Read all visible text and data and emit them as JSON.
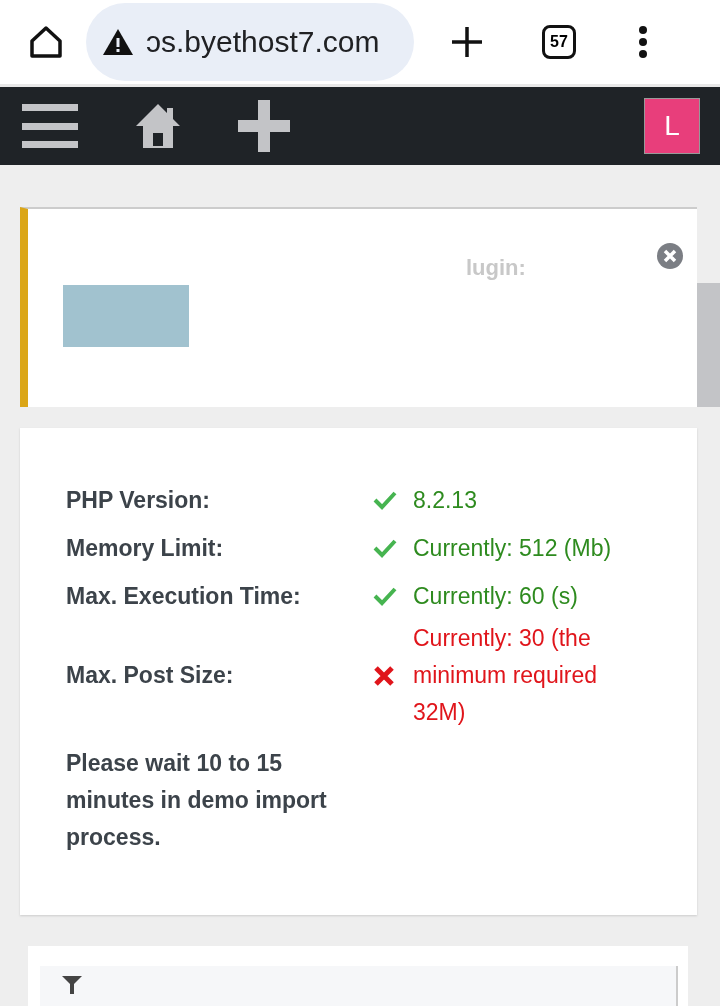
{
  "browser": {
    "url": "ɔs.byethost7.com",
    "tab_count": "57"
  },
  "admin_bar": {
    "avatar_letter": "L"
  },
  "notice": {
    "title_fragment": "lugin:"
  },
  "requirements": [
    {
      "label": "PHP Version:",
      "passed": true,
      "value": "8.2.13"
    },
    {
      "label": "Memory Limit:",
      "passed": true,
      "value": "Currently: 512 (Mb)"
    },
    {
      "label": "Max. Execution Time:",
      "passed": true,
      "value": "Currently: 60 (s)"
    },
    {
      "label": "Max. Post Size:",
      "passed": false,
      "value": "Currently: 30 (the minimum required 32M)"
    }
  ],
  "wait_note": "Please wait 10 to 15 minutes in demo import process."
}
